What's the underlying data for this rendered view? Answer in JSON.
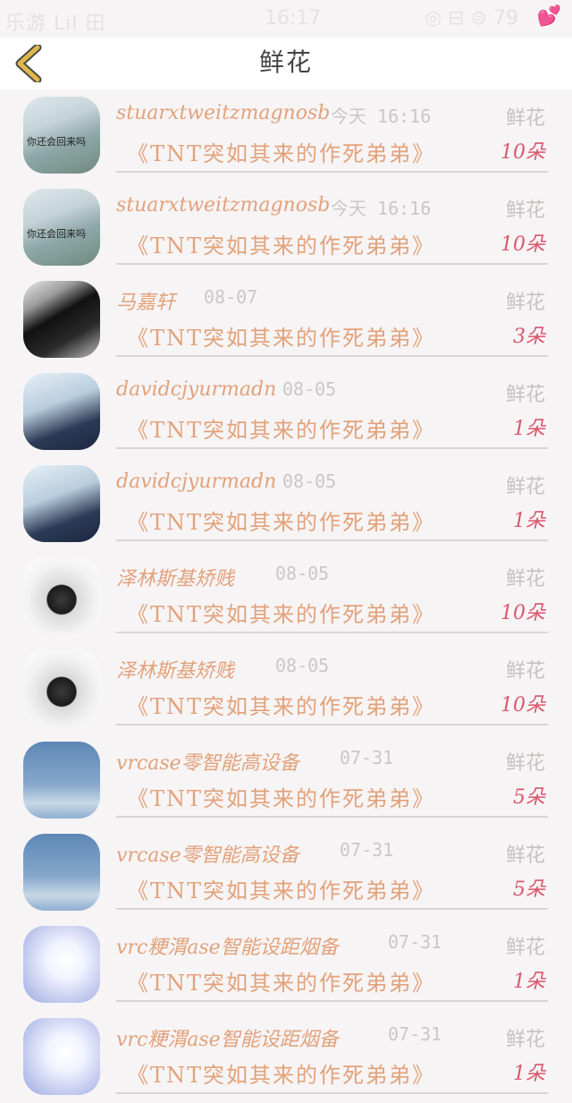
{
  "status_bar": {
    "left": "乐游 Lıl 田",
    "time": "16:17",
    "right": "◎ ⊟ ⊜ 79",
    "hearts": "💕"
  },
  "header": {
    "title": "鲜花",
    "back_icon": "chevron-left-icon"
  },
  "accent_colors": {
    "back": "#e0b84a",
    "name": "#e2a27b",
    "count": "#d9576d"
  },
  "items": [
    {
      "name": "stuarxtweitzmagnosb",
      "date": "今天 16:16",
      "gift_type": "鲜花",
      "work": "《TNT突如其来的作死弟弟》",
      "count": "10朵",
      "avatar_caption": "你还会回来吗"
    },
    {
      "name": "stuarxtweitzmagnosb",
      "date": "今天 16:16",
      "gift_type": "鲜花",
      "work": "《TNT突如其来的作死弟弟》",
      "count": "10朵",
      "avatar_caption": "你还会回来吗"
    },
    {
      "name": "马嘉轩",
      "date": "08-07",
      "gift_type": "鲜花",
      "work": "《TNT突如其来的作死弟弟》",
      "count": "3朵",
      "avatar_caption": ""
    },
    {
      "name": "davidcjyurmadn",
      "date": "08-05",
      "gift_type": "鲜花",
      "work": "《TNT突如其来的作死弟弟》",
      "count": "1朵",
      "avatar_caption": ""
    },
    {
      "name": "davidcjyurmadn",
      "date": "08-05",
      "gift_type": "鲜花",
      "work": "《TNT突如其来的作死弟弟》",
      "count": "1朵",
      "avatar_caption": ""
    },
    {
      "name": "泽林斯基矫贱",
      "date": "08-05",
      "gift_type": "鲜花",
      "work": "《TNT突如其来的作死弟弟》",
      "count": "10朵",
      "avatar_caption": ""
    },
    {
      "name": "泽林斯基矫贱",
      "date": "08-05",
      "gift_type": "鲜花",
      "work": "《TNT突如其来的作死弟弟》",
      "count": "10朵",
      "avatar_caption": ""
    },
    {
      "name": "vrcase零智能高设备",
      "date": "07-31",
      "gift_type": "鲜花",
      "work": "《TNT突如其来的作死弟弟》",
      "count": "5朵",
      "avatar_caption": ""
    },
    {
      "name": "vrcase零智能高设备",
      "date": "07-31",
      "gift_type": "鲜花",
      "work": "《TNT突如其来的作死弟弟》",
      "count": "5朵",
      "avatar_caption": ""
    },
    {
      "name": "vrc粳渭ase智能设距烟备",
      "date": "07-31",
      "gift_type": "鲜花",
      "work": "《TNT突如其来的作死弟弟》",
      "count": "1朵",
      "avatar_caption": ""
    },
    {
      "name": "vrc粳渭ase智能设距烟备",
      "date": "07-31",
      "gift_type": "鲜花",
      "work": "《TNT突如其来的作死弟弟》",
      "count": "1朵",
      "avatar_caption": ""
    }
  ]
}
